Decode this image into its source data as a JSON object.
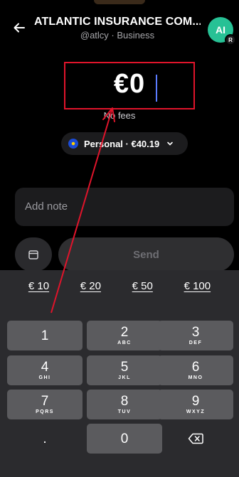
{
  "header": {
    "title": "ATLANTIC INSURANCE COM...",
    "subtitle": "@atlcy · Business",
    "avatar_initials": "AI",
    "avatar_badge": "R",
    "avatar_color": "#27c195"
  },
  "amount": {
    "value": "€0",
    "fees_text": "No fees"
  },
  "account": {
    "label": "Personal · €40.19"
  },
  "note": {
    "placeholder": "Add note"
  },
  "actions": {
    "send_label": "Send"
  },
  "presets": [
    "€ 10",
    "€ 20",
    "€ 50",
    "€ 100"
  ],
  "keys": [
    {
      "num": "1",
      "letters": ""
    },
    {
      "num": "2",
      "letters": "ABC"
    },
    {
      "num": "3",
      "letters": "DEF"
    },
    {
      "num": "4",
      "letters": "GHI"
    },
    {
      "num": "5",
      "letters": "JKL"
    },
    {
      "num": "6",
      "letters": "MNO"
    },
    {
      "num": "7",
      "letters": "PQRS"
    },
    {
      "num": "8",
      "letters": "TUV"
    },
    {
      "num": "9",
      "letters": "WXYZ"
    },
    {
      "num": ".",
      "letters": ""
    },
    {
      "num": "0",
      "letters": ""
    }
  ],
  "colors": {
    "highlight_box": "#e0142b",
    "arrow": "#e0142b",
    "caret": "#5b7cff"
  }
}
